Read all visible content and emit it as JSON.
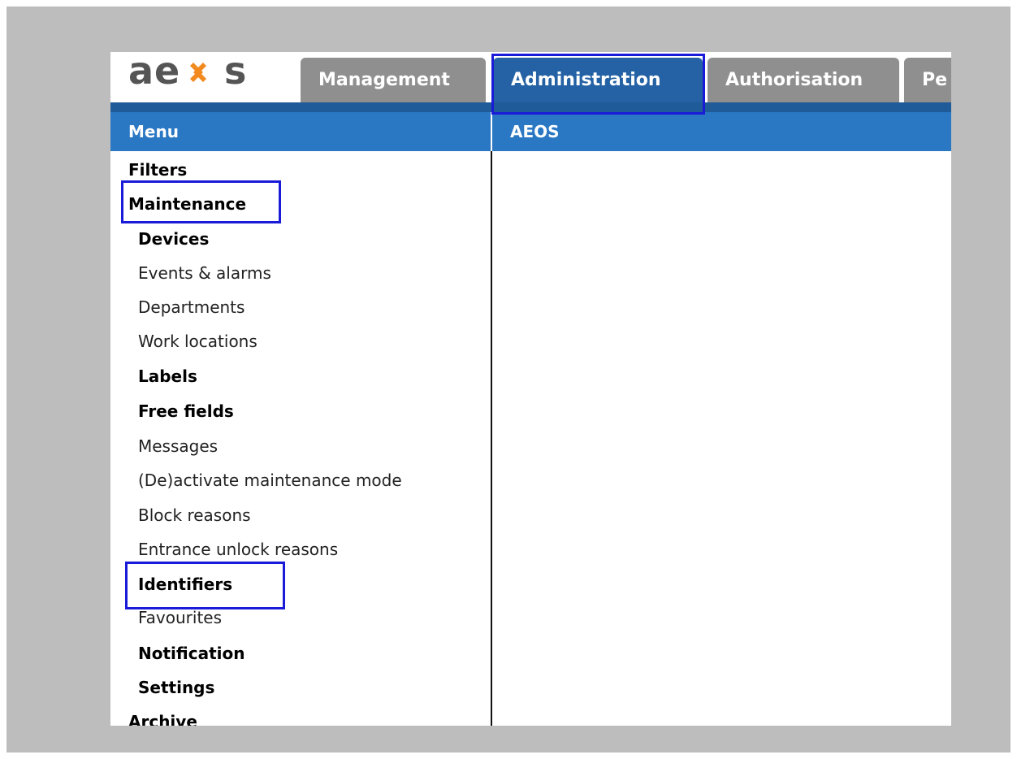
{
  "app": {
    "logo_text": "aeos",
    "logo_colors": {
      "text": "#555555",
      "accent": "#f28a1e"
    }
  },
  "tabs": [
    {
      "label": "Management",
      "active": false
    },
    {
      "label": "Administration",
      "active": true
    },
    {
      "label": "Authorisation",
      "active": false
    },
    {
      "label": "Pe",
      "active": false
    }
  ],
  "header": {
    "menu_title": "Menu",
    "content_title": "AEOS"
  },
  "menu": {
    "items": [
      {
        "label": "Filters",
        "level": 1
      },
      {
        "label": "Maintenance",
        "level": 1
      },
      {
        "label": "Devices",
        "level": 2,
        "bold": true
      },
      {
        "label": "Events & alarms",
        "level": 2
      },
      {
        "label": "Departments",
        "level": 2
      },
      {
        "label": "Work locations",
        "level": 2
      },
      {
        "label": "Labels",
        "level": 2,
        "bold": true
      },
      {
        "label": "Free fields",
        "level": 2,
        "bold": true
      },
      {
        "label": "Messages",
        "level": 2
      },
      {
        "label": "(De)activate maintenance mode",
        "level": 2
      },
      {
        "label": "Block reasons",
        "level": 2
      },
      {
        "label": "Entrance unlock reasons",
        "level": 2
      },
      {
        "label": "Identifiers",
        "level": 2,
        "bold": true
      },
      {
        "label": "Favourites",
        "level": 2
      },
      {
        "label": "Notification",
        "level": 2,
        "bold": true
      },
      {
        "label": "Settings",
        "level": 2,
        "bold": true
      },
      {
        "label": "Archive",
        "level": 1
      }
    ]
  },
  "colors": {
    "background": "#bdbdbd",
    "tab_inactive": "#8f8f8f",
    "tab_active": "#2462a5",
    "header_bar": "#2a77c4",
    "highlight_box": "#1a1ad9"
  }
}
